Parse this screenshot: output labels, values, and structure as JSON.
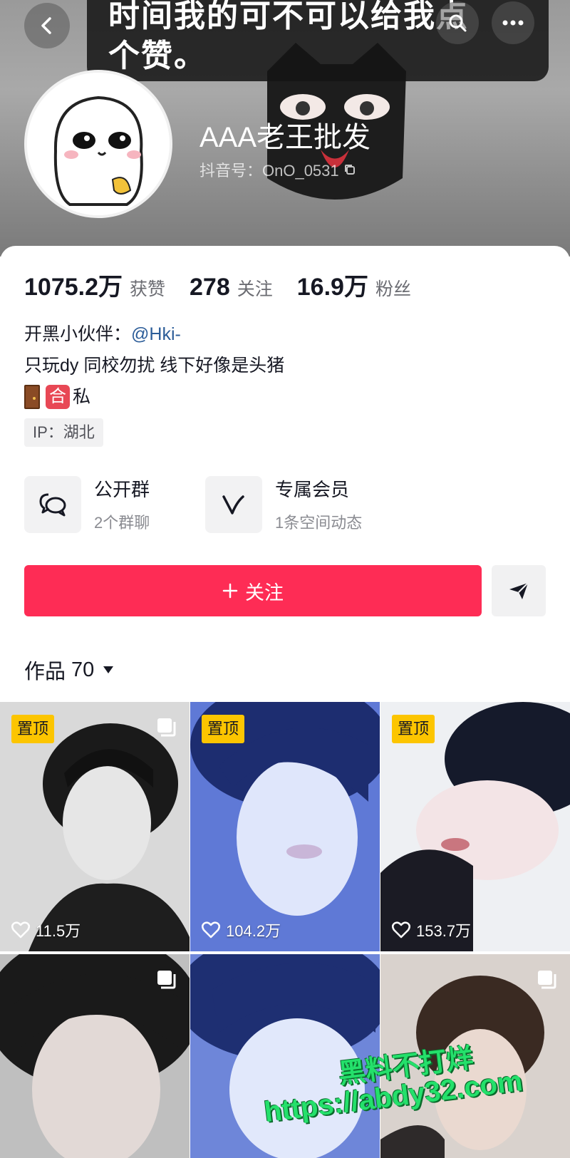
{
  "header": {
    "caption_line1": "时间我的可不可以给我点",
    "caption_line2": "个赞。",
    "display_name": "AAA老王批发",
    "account_id": "抖音号：OnO_0531"
  },
  "stats": [
    {
      "value": "1075.2万",
      "label": "获赞"
    },
    {
      "value": "278",
      "label": "关注"
    },
    {
      "value": "16.9万",
      "label": "粉丝"
    }
  ],
  "bio": {
    "line1_prefix": "开黑小伙伴：",
    "line1_mention": "@Hki-",
    "line2": "只玩dy  同校勿扰  线下好像是头猪",
    "line3_badge": "合",
    "line3_text": "私"
  },
  "ip_tag": "IP：湖北",
  "features": {
    "group": {
      "title": "公开群",
      "subtitle": "2个群聊"
    },
    "member": {
      "title": "专属会员",
      "subtitle": "1条空间动态"
    }
  },
  "follow_button": {
    "label": "关注"
  },
  "works_tab": {
    "label": "作品",
    "count": "70"
  },
  "grid": [
    {
      "pinned": "置顶",
      "likes": "11.5万",
      "tone": "#d9d9d9"
    },
    {
      "pinned": "置顶",
      "likes": "104.2万",
      "tone": "#5f79d6"
    },
    {
      "pinned": "置顶",
      "likes": "153.7万",
      "tone": "#eef0f3"
    },
    {
      "pinned": "",
      "likes": "",
      "tone": "#bfbfbf"
    },
    {
      "pinned": "",
      "likes": "",
      "tone": "#6e86d9"
    },
    {
      "pinned": "",
      "likes": "",
      "tone": "#d9d2cd"
    }
  ],
  "watermark": {
    "line1": "黑料不打烊",
    "line2": "https://abdy32.com"
  },
  "colors": {
    "accent": "#fe2c55",
    "mention": "#2b5c98",
    "pin_badge": "#fcc500",
    "watermark": "#24e06b"
  }
}
